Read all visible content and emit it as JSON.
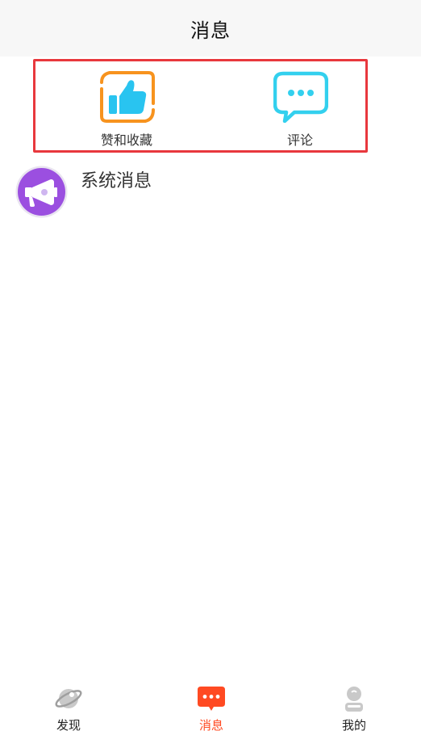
{
  "header": {
    "title": "消息"
  },
  "shortcuts": {
    "likes_label": "赞和收藏",
    "comments_label": "评论",
    "likes_icon": "thumbs-up-icon",
    "comments_icon": "comment-bubble-icon"
  },
  "system_message": {
    "title": "系统消息",
    "icon": "megaphone-icon"
  },
  "tabbar": {
    "tabs": [
      {
        "label": "发现",
        "icon": "planet-icon",
        "active": false
      },
      {
        "label": "消息",
        "icon": "chat-bubble-icon",
        "active": true
      },
      {
        "label": "我的",
        "icon": "user-icon",
        "active": false
      }
    ]
  },
  "colors": {
    "accent": "#ff4a22",
    "highlight_border": "#e8383d",
    "likes_orange": "#f7931e",
    "likes_blue": "#29c4f0",
    "comments_cyan": "#33d0ee",
    "system_purple": "#9b4fe0"
  }
}
